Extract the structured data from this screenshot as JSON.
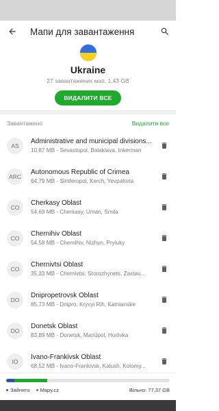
{
  "app_bar": {
    "title": "Мапи для завантаження"
  },
  "header": {
    "country": "Ukraine",
    "subtitle": "27 завантажених мап, 1,43 GB",
    "delete_all_button": "ВИДАЛИТИ ВСЕ",
    "flag_colors": [
      "#2f6fde",
      "#f5d01e"
    ]
  },
  "section": {
    "label": "Завантажено",
    "action": "Видалити все"
  },
  "items": [
    {
      "code": "AS",
      "name": "Administrative and municipal divisions...",
      "info": "10,87 MB - Sevastopol, Balaklava, Inkerman"
    },
    {
      "code": "ARC",
      "name": "Autonomous Republic of Crimea",
      "info": "64,79 MB - Simferopol, Kerch, Yevpatoria"
    },
    {
      "code": "CO",
      "name": "Cherkasy Oblast",
      "info": "54,69 MB - Cherkasy, Uman, Smila"
    },
    {
      "code": "CO",
      "name": "Chernihiv Oblast",
      "info": "54,58 MB - Chernihiv, Nizhyn, Pryluky"
    },
    {
      "code": "CO",
      "name": "Chernivtsi Oblast",
      "info": "35,33 MB - Chernivtsi, Storozhynets, Zastav..."
    },
    {
      "code": "DO",
      "name": "Dnipropetrovsk Oblast",
      "info": "85,73 MB - Dnipro, Kryvyi Rih, Kamianske"
    },
    {
      "code": "DO",
      "name": "Donetsk Oblast",
      "info": "83,89 MB - Donetsk, Mariúpol, Horlivka"
    },
    {
      "code": "IO",
      "name": "Ivano-Frankivsk Oblast",
      "info": "68,52 MB - Ivano-Frankivsk, Kalush, Kolomy..."
    }
  ],
  "storage": {
    "used_other_fraction": 0.05,
    "used_mapy_fraction": 0.2,
    "legend_used": "Зайнято",
    "legend_app": "Mapy.cz",
    "free_text": "Вільно: 77,37 GB"
  },
  "colors": {
    "accent_green": "#1faa2e",
    "storage_blue": "#2a56a8",
    "icon_gray": "#5f5f5f"
  }
}
